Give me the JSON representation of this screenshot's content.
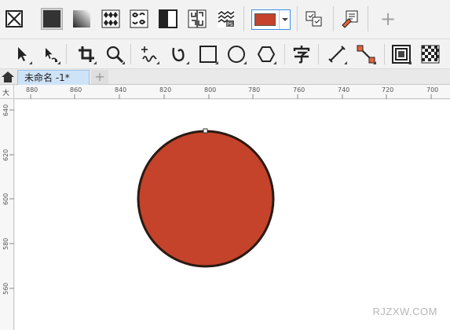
{
  "toolbar_fill": {
    "buttons": [
      "no-fill",
      "uniform-fill",
      "fountain-fill",
      "vector-pattern-fill",
      "bitmap-pattern-fill",
      "two-color-pattern-fill",
      "texture-fill",
      "postscript-fill"
    ],
    "fill_color": "#c4432a",
    "actions": [
      "color-eyedropper",
      "attributes-eyedropper"
    ],
    "add_label": "+"
  },
  "toolbar_tools": [
    "pick-tool",
    "shape-tool",
    "crop-tool",
    "zoom-tool",
    "freehand-tool",
    "artistic-media-tool",
    "rectangle-tool",
    "ellipse-tool",
    "polygon-tool",
    "text-tool",
    "parallel-dimension-tool",
    "connector-tool",
    "drop-shadow-tool",
    "transparency-tool"
  ],
  "tabs": {
    "document_title": "未命名 -1*",
    "add_label": "+"
  },
  "ruler": {
    "unit": "mm",
    "top_labels": [
      "880",
      "860",
      "840",
      "820",
      "800",
      "780",
      "760",
      "740",
      "720",
      "700"
    ],
    "left_labels": [
      "640",
      "620",
      "600",
      "580",
      "560"
    ],
    "corner_label": "大"
  },
  "shape": {
    "type": "circle",
    "fill": "#c4432a",
    "stroke": "#2a1a14"
  },
  "watermark": "RJZXW.COM"
}
